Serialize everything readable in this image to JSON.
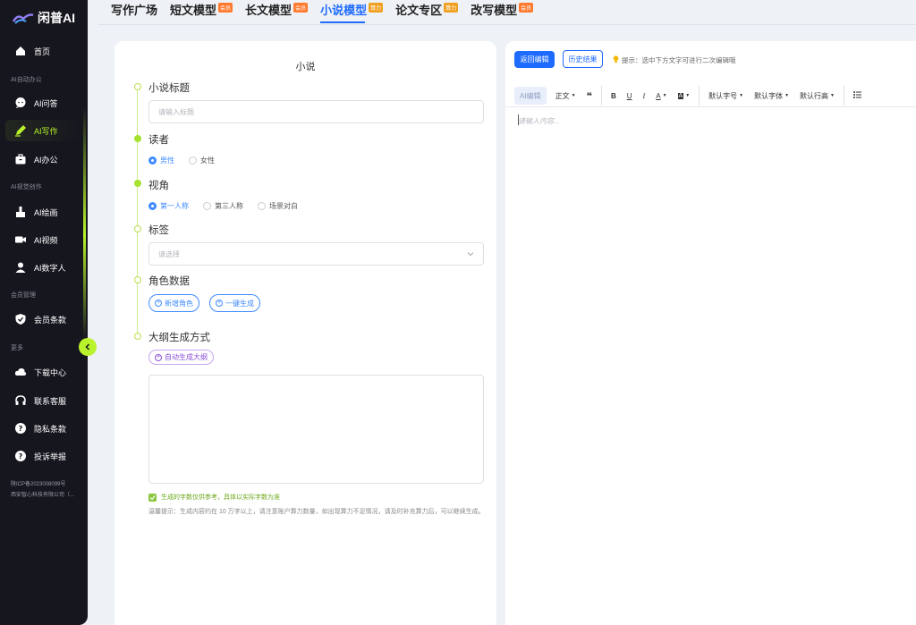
{
  "app": {
    "name": "闲普AI"
  },
  "sidebar": {
    "sections": {
      "office": "AI自动办公",
      "visual": "AI视觉创作",
      "member": "会员管理",
      "more": "更多"
    },
    "items": [
      {
        "label": "首页",
        "icon": "home-icon"
      },
      {
        "label": "AI问答",
        "icon": "chat-icon"
      },
      {
        "label": "AI写作",
        "icon": "pen-icon"
      },
      {
        "label": "AI办公",
        "icon": "briefcase-icon"
      },
      {
        "label": "AI绘画",
        "icon": "paint-icon"
      },
      {
        "label": "AI视频",
        "icon": "video-icon"
      },
      {
        "label": "AI数字人",
        "icon": "person-icon"
      },
      {
        "label": "会员条款",
        "icon": "shield-icon"
      },
      {
        "label": "下载中心",
        "icon": "cloud-icon"
      },
      {
        "label": "联系客服",
        "icon": "headset-icon"
      },
      {
        "label": "隐私条款",
        "icon": "help-icon"
      },
      {
        "label": "投诉举报",
        "icon": "help-icon"
      }
    ],
    "footer": {
      "icp": "陕ICP备2023008099号",
      "company": "西安智心科技有限公司（..."
    },
    "active_color": "#b8f32b"
  },
  "tabs": [
    {
      "label": "写作广场",
      "badge": ""
    },
    {
      "label": "短文模型",
      "badge": "会员"
    },
    {
      "label": "长文模型",
      "badge": "会员"
    },
    {
      "label": "小说模型",
      "badge": "算力"
    },
    {
      "label": "论文专区",
      "badge": "算力"
    },
    {
      "label": "改写模型",
      "badge": "会员"
    }
  ],
  "form": {
    "title": "小说",
    "novel_title": {
      "label": "小说标题",
      "placeholder": "请输入标题"
    },
    "reader": {
      "label": "读者",
      "options": [
        "男性",
        "女性"
      ],
      "selected": "男性"
    },
    "perspective": {
      "label": "视角",
      "options": [
        "第一人称",
        "第三人称",
        "场景对白"
      ],
      "selected": "第一人称"
    },
    "tags": {
      "label": "标签",
      "placeholder": "请选择"
    },
    "characters": {
      "label": "角色数据",
      "add_button": "新增角色",
      "generate_button": "一键生成"
    },
    "outline": {
      "label": "大纲生成方式",
      "auto_button": "自动生成大纲"
    },
    "disclaimer": "生成的字数仅供参考，具体以实际字数为准",
    "tip": "温馨提示：生成内容约在 10 万字以上，请注意账户算力数量，如出现算力不足情况，请及时补充算力后，可以继续生成。"
  },
  "editor": {
    "back_button": "返回编辑",
    "history_button": "历史结果",
    "hint": "提示：选中下方文字可进行二次编辑哦",
    "toolbar": {
      "ai": "AI编辑",
      "paragraph": "正文",
      "font_size": "默认字号",
      "font_family": "默认字体",
      "line_height": "默认行高"
    },
    "placeholder": "请输入内容..."
  },
  "colors": {
    "primary": "#1e6bff",
    "accent": "#b8f32b",
    "sidebar_bg": "#16161f"
  }
}
